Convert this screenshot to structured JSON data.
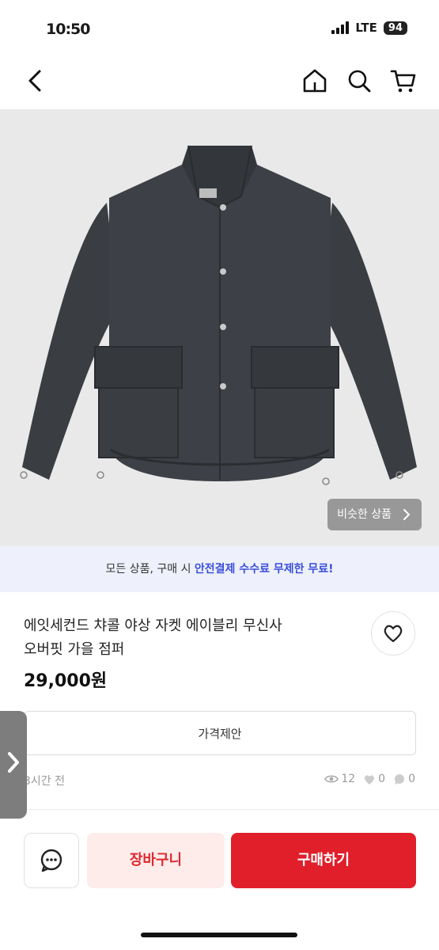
{
  "status_bar": {
    "time": "10:50",
    "network": "LTE",
    "battery": "94"
  },
  "header": {
    "back_icon": "chevron-left-icon",
    "home_icon": "home-icon",
    "search_icon": "search-icon",
    "cart_icon": "cart-icon"
  },
  "product_image": {
    "subject": "charcoal field jacket",
    "similar_label": "비슷한 상품"
  },
  "banner": {
    "text_prefix": "모든 상품, 구매 시 ",
    "text_highlight": "안전결제 수수료 무제한 무료!"
  },
  "product": {
    "title_line1": "에잇세컨드 챠콜 야상 자켓 에이블리 무신사",
    "title_line2": "오버핏 가을 점퍼",
    "price": "29,000원",
    "offer_label": "가격제안",
    "posted": "3시간 전",
    "views": "12",
    "likes": "0",
    "chats": "0"
  },
  "bottom_bar": {
    "cart_label": "장바구니",
    "buy_label": "구매하기"
  },
  "colors": {
    "accent_red": "#e01f2a",
    "cart_bg": "#fdecea",
    "banner_bg": "#eef1fb",
    "banner_highlight": "#3a4fd9",
    "jacket": "#3a3d42"
  }
}
